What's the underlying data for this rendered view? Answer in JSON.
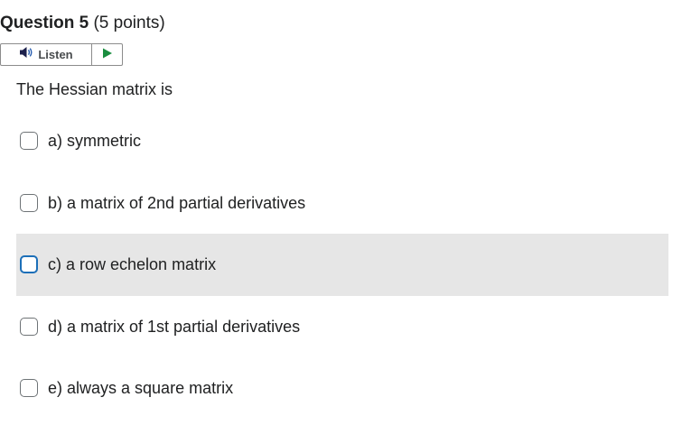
{
  "question": {
    "title": "Question 5",
    "points": "(5 points)",
    "stem": "The Hessian matrix is"
  },
  "listen": {
    "label": "Listen",
    "speaker_icon": "speaker-icon",
    "play_icon": "play-icon",
    "accent_color": "#1a8d3f"
  },
  "options": [
    {
      "label": "a) symmetric",
      "highlighted": false,
      "checked": false
    },
    {
      "label": "b) a matrix of 2nd partial derivatives",
      "highlighted": false,
      "checked": false
    },
    {
      "label": "c) a row echelon matrix",
      "highlighted": true,
      "checked": false
    },
    {
      "label": "d) a matrix of 1st partial derivatives",
      "highlighted": false,
      "checked": false
    },
    {
      "label": "e) always a square matrix",
      "highlighted": false,
      "checked": false
    }
  ],
  "colors": {
    "focus_border": "#1c6fb8",
    "highlight_background": "#e6e6e6",
    "text": "#202122"
  }
}
